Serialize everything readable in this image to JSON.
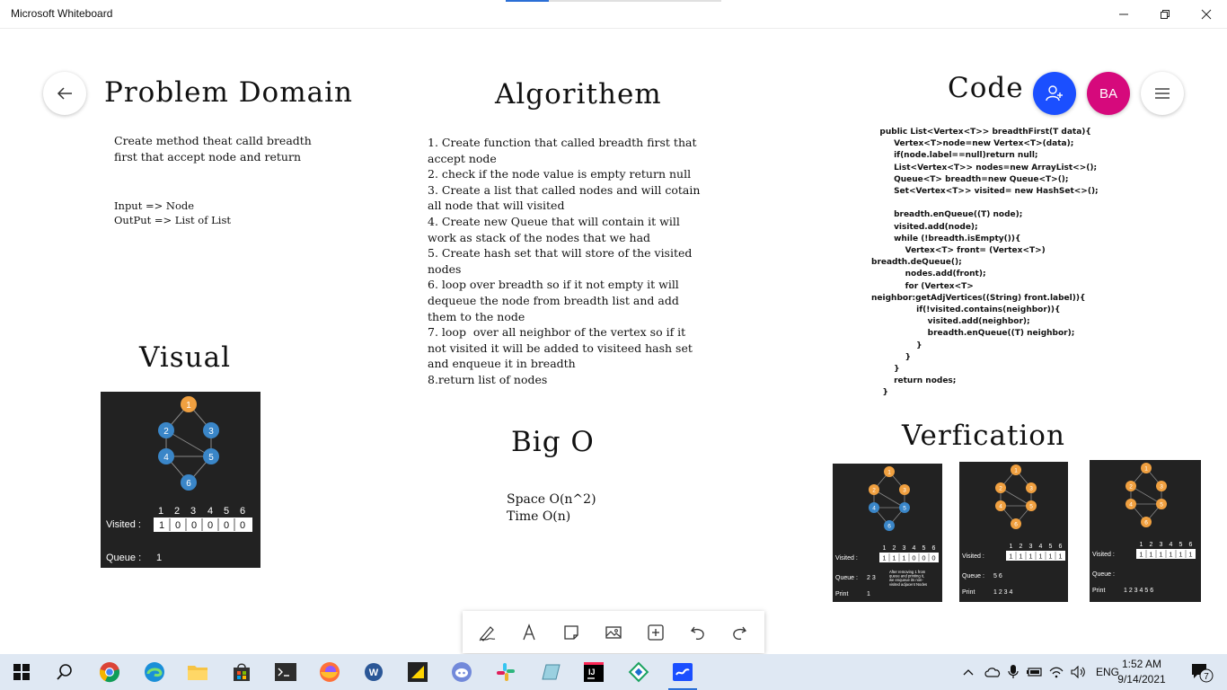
{
  "window": {
    "title": "Microsoft Whiteboard",
    "progress": 0.2
  },
  "colors": {
    "accent_blue": "#1b4fff",
    "user_pink": "#d6097c",
    "node_orange": "#f0a040",
    "node_blue": "#3a86c8",
    "panel_bg": "#222222",
    "taskbar_bg": "#dfe8f3"
  },
  "board": {
    "problem_domain": {
      "heading": "Problem Domain",
      "description": "Create method theat calld breadth\nfirst that accept node and return",
      "io": "Input => Node\nOutPut => List of List"
    },
    "algorithm": {
      "heading": "Algorithem",
      "steps": "1. Create function that called breadth first that\naccept node\n2. check if the node value is empty return null\n3. Create a list that called nodes and will cotain\nall node that will visited\n4. Create new Queue that will contain it will\nwork as stack of the nodes that we had\n5. Create hash set that will store of the visited\nnodes\n6. loop over breadth so if it not empty it will\ndequeue the node from breadth list and add\nthem to the node\n7. loop  over all neighbor of the vertex so if it\nnot visited it will be added to visiteed hash set\nand enqueue it in breadth\n8.return list of nodes"
    },
    "code": {
      "heading": "Code",
      "body": "   public List<Vertex<T>> breadthFirst(T data){\n        Vertex<T>node=new Vertex<T>(data);\n        if(node.label==null)return null;\n        List<Vertex<T>> nodes=new ArrayList<>();\n        Queue<T> breadth=new Queue<T>();\n        Set<Vertex<T>> visited= new HashSet<>();\n\n        breadth.enQueue((T) node);\n        visited.add(node);\n        while (!breadth.isEmpty()){\n            Vertex<T> front= (Vertex<T>)\nbreadth.deQueue();\n            nodes.add(front);\n            for (Vertex<T>\nneighbor:getAdjVertices((String) front.label)){\n                if(!visited.contains(neighbor)){\n                    visited.add(neighbor);\n                    breadth.enQueue((T) neighbor);\n                }\n            }\n        }\n        return nodes;\n    }"
    },
    "visual": {
      "heading": "Visual",
      "graph": {
        "nodes": [
          "1",
          "2",
          "3",
          "4",
          "5",
          "6"
        ],
        "visited_indices": [
          "1",
          "2",
          "3",
          "4",
          "5",
          "6"
        ],
        "visited_label": "Visited :",
        "visited_values": [
          "1",
          "0",
          "0",
          "0",
          "0",
          "0"
        ],
        "queue_label": "Queue :",
        "queue_value": "1"
      }
    },
    "big_o": {
      "heading": "Big O",
      "body": "Space O(n^2)\nTime O(n)"
    },
    "verification": {
      "heading": "Verfication",
      "panels": [
        {
          "visited_label": "Visited :",
          "visited_values": [
            "1",
            "1",
            "1",
            "0",
            "0",
            "0"
          ],
          "queue_label": "Queue :",
          "queue_value": "2  3",
          "note": "After removing 1 from\nqueue and printing it,\nwe enqueue its non-\nvisited adjacent Nodes",
          "print_label": "Print",
          "print_value": "1"
        },
        {
          "visited_label": "Visited :",
          "visited_values": [
            "1",
            "1",
            "1",
            "1",
            "1",
            "1"
          ],
          "queue_label": "Queue :",
          "queue_value": "5  6",
          "note": "",
          "print_label": "Print",
          "print_value": "1  2  3  4"
        },
        {
          "visited_label": "Visited :",
          "visited_values": [
            "1",
            "1",
            "1",
            "1",
            "1",
            "1"
          ],
          "queue_label": "Queue :",
          "queue_value": "",
          "note": "",
          "print_label": "Print",
          "print_value": "1  2  3  4  5  6"
        }
      ]
    }
  },
  "top_right": {
    "user_initials": "BA"
  },
  "toolbar": {
    "tools": [
      "pen-icon",
      "text-icon",
      "note-icon",
      "image-icon",
      "insert-icon",
      "undo-icon",
      "redo-icon"
    ]
  },
  "taskbar": {
    "language": "ENG",
    "time": "1:52 AM",
    "date": "9/14/2021",
    "notification_count": "7"
  }
}
